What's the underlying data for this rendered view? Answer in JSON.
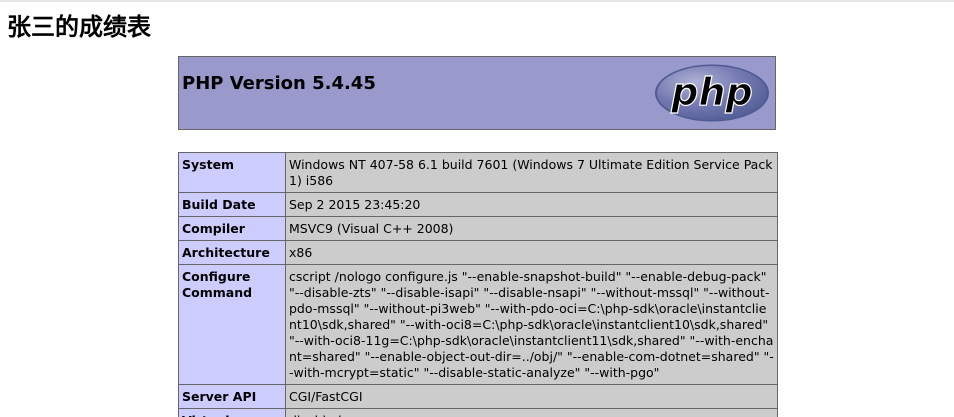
{
  "page": {
    "title": "张三的成绩表"
  },
  "php_header": {
    "version_text": "PHP Version 5.4.45",
    "logo_text": "php",
    "logo_icon": "php-logo-icon"
  },
  "info_rows": [
    {
      "key": "System",
      "value": "Windows NT 407-58 6.1 build 7601 (Windows 7 Ultimate Edition Service Pack 1) i586"
    },
    {
      "key": "Build Date",
      "value": "Sep 2 2015 23:45:20"
    },
    {
      "key": "Compiler",
      "value": "MSVC9 (Visual C++ 2008)"
    },
    {
      "key": "Architecture",
      "value": "x86"
    },
    {
      "key": "Configure Command",
      "value": "cscript /nologo configure.js \"--enable-snapshot-build\" \"--enable-debug-pack\" \"--disable-zts\" \"--disable-isapi\" \"--disable-nsapi\" \"--without-mssql\" \"--without-pdo-mssql\" \"--without-pi3web\" \"--with-pdo-oci=C:\\php-sdk\\oracle\\instantclient10\\sdk,shared\" \"--with-oci8=C:\\php-sdk\\oracle\\instantclient10\\sdk,shared\" \"--with-oci8-11g=C:\\php-sdk\\oracle\\instantclient11\\sdk,shared\" \"--with-enchant=shared\" \"--enable-object-out-dir=../obj/\" \"--enable-com-dotnet=shared\" \"--with-mcrypt=static\" \"--disable-static-analyze\" \"--with-pgo\""
    },
    {
      "key": "Server API",
      "value": "CGI/FastCGI"
    },
    {
      "key": "Virtual",
      "value": "disabled"
    }
  ],
  "colors": {
    "header_bg": "#9999cc",
    "key_bg": "#ccccff",
    "value_bg": "#cccccc"
  }
}
